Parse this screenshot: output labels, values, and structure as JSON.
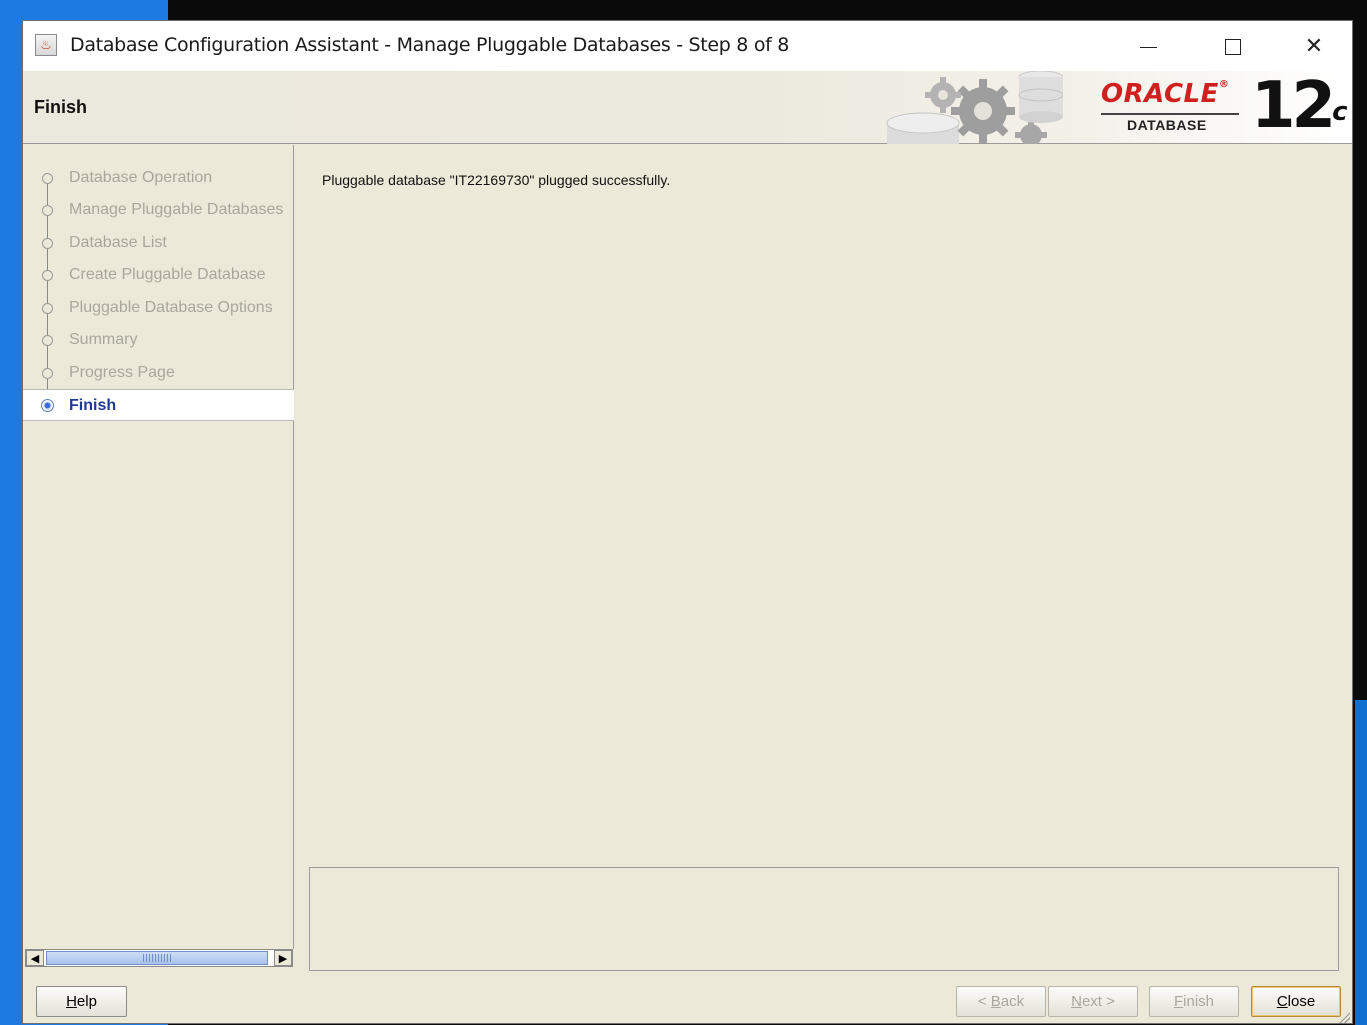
{
  "window": {
    "title": "Database Configuration Assistant - Manage Pluggable Databases - Step 8 of 8",
    "icon": "java-coffee-icon",
    "controls": {
      "minimize": "minimize-icon",
      "maximize": "maximize-icon",
      "close": "✕"
    }
  },
  "header": {
    "page_title": "Finish",
    "brand": {
      "name": "ORACLE",
      "registered": "®",
      "product": "DATABASE",
      "version": "12",
      "version_suffix": "c"
    }
  },
  "nav": {
    "items": [
      {
        "label": "Database Operation",
        "state": "done"
      },
      {
        "label": "Manage Pluggable Databases",
        "state": "done"
      },
      {
        "label": "Database List",
        "state": "done"
      },
      {
        "label": "Create Pluggable Database",
        "state": "done"
      },
      {
        "label": "Pluggable Database Options",
        "state": "done"
      },
      {
        "label": "Summary",
        "state": "done"
      },
      {
        "label": "Progress Page",
        "state": "done"
      },
      {
        "label": "Finish",
        "state": "active"
      }
    ]
  },
  "content": {
    "message": "Pluggable database \"IT22169730\" plugged successfully.",
    "details": ""
  },
  "footer": {
    "help": {
      "pre": "",
      "key": "H",
      "post": "elp"
    },
    "back": {
      "pre": "< ",
      "key": "B",
      "post": "ack"
    },
    "next": {
      "pre": "",
      "key": "N",
      "post": "ext >"
    },
    "finish": {
      "pre": "",
      "key": "F",
      "post": "inish"
    },
    "close": {
      "pre": "",
      "key": "C",
      "post": "lose"
    }
  },
  "colors": {
    "panel": "#ece9d8",
    "active_text": "#1f3a93",
    "disabled_text": "#a9a79c",
    "oracle_red": "#d01f1f"
  }
}
